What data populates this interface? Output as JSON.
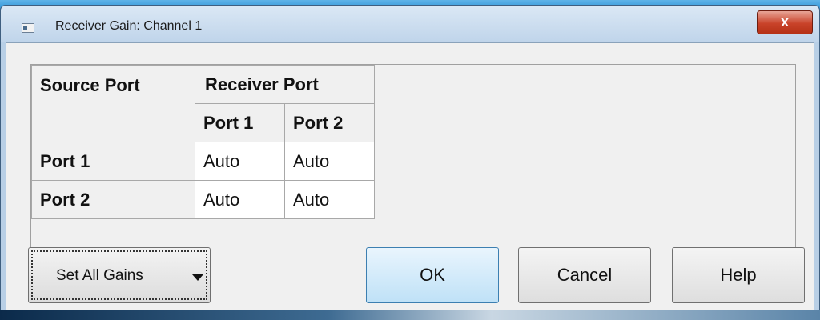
{
  "window": {
    "title": "Receiver Gain: Channel 1",
    "close_glyph": "x"
  },
  "table": {
    "source_port_header": "Source Port",
    "receiver_port_header": "Receiver Port",
    "columns": [
      "Port 1",
      "Port 2"
    ],
    "rows": [
      {
        "label": "Port 1",
        "values": [
          "Auto",
          "Auto"
        ]
      },
      {
        "label": "Port 2",
        "values": [
          "Auto",
          "Auto"
        ]
      }
    ]
  },
  "buttons": {
    "set_all_gains": "Set All Gains",
    "ok": "OK",
    "cancel": "Cancel",
    "help": "Help"
  },
  "icons": {
    "window_icon": "window-app-icon",
    "dropdown": "caret-down-icon"
  },
  "colors": {
    "titlebar": "#bfd4ea",
    "close": "#c9432a",
    "ok_button": "#bfe1f7"
  }
}
